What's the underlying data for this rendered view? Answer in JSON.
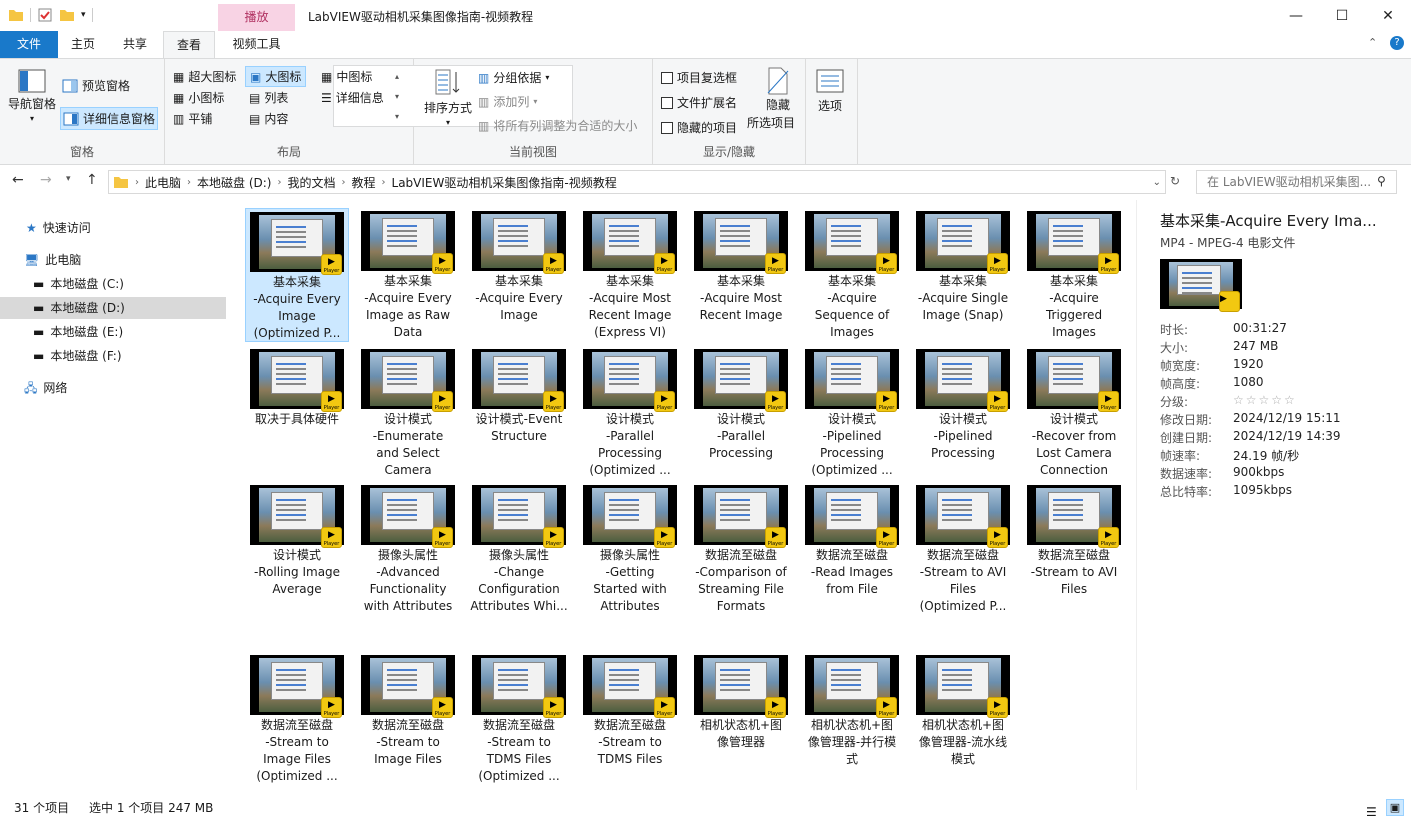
{
  "window": {
    "title": "LabVIEW驱动相机采集图像指南-视频教程",
    "play_tab": "播放",
    "minimize": "—",
    "maximize": "☐",
    "close": "✕"
  },
  "tabs": [
    "文件",
    "主页",
    "共享",
    "查看",
    "视频工具"
  ],
  "ribbon": {
    "pane": {
      "nav_pane": "导航窗格",
      "preview_pane": "预览窗格",
      "details_pane": "详细信息窗格",
      "label": "窗格"
    },
    "layout": {
      "items": [
        "超大图标",
        "大图标",
        "中图标",
        "小图标",
        "列表",
        "详细信息",
        "平铺",
        "内容"
      ],
      "label": "布局"
    },
    "view": {
      "sort": "排序方式",
      "group_by": "分组依据",
      "add_column": "添加列",
      "fit_columns": "将所有列调整为合适的大小",
      "label": "当前视图"
    },
    "show": {
      "item_checkbox": "项目复选框",
      "file_ext": "文件扩展名",
      "hidden_items": "隐藏的项目",
      "hide_selected": "隐藏",
      "hide_selected2": "所选项目",
      "label": "显示/隐藏"
    },
    "options": "选项"
  },
  "address": {
    "crumbs": [
      "此电脑",
      "本地磁盘 (D:)",
      "我的文档",
      "教程",
      "LabVIEW驱动相机采集图像指南-视频教程"
    ],
    "search_placeholder": "在 LabVIEW驱动相机采集图..."
  },
  "nav": {
    "quick": "快速访问",
    "pc": "此电脑",
    "c": "本地磁盘 (C:)",
    "d": "本地磁盘 (D:)",
    "e": "本地磁盘 (E:)",
    "f": "本地磁盘 (F:)",
    "net": "网络"
  },
  "files": [
    "基本采集\n-Acquire Every\nImage\n(Optimized P...",
    "基本采集\n-Acquire Every\nImage as Raw\nData",
    "基本采集\n-Acquire Every\nImage",
    "基本采集\n-Acquire Most\nRecent Image\n(Express VI)",
    "基本采集\n-Acquire Most\nRecent Image",
    "基本采集\n-Acquire\nSequence of\nImages",
    "基本采集\n-Acquire Single\nImage (Snap)",
    "基本采集\n-Acquire\nTriggered\nImages",
    "取决于具体硬件",
    "设计模式\n-Enumerate\nand Select\nCamera",
    "设计模式-Event\nStructure",
    "设计模式\n-Parallel\nProcessing\n(Optimized ...",
    "设计模式\n-Parallel\nProcessing",
    "设计模式\n-Pipelined\nProcessing\n(Optimized ...",
    "设计模式\n-Pipelined\nProcessing",
    "设计模式\n-Recover from\nLost Camera\nConnection",
    "设计模式\n-Rolling Image\nAverage",
    "摄像头属性\n-Advanced\nFunctionality\nwith Attributes",
    "摄像头属性\n-Change\nConfiguration\nAttributes Whi...",
    "摄像头属性\n-Getting\nStarted with\nAttributes",
    "数据流至磁盘\n-Comparison of\nStreaming File\nFormats",
    "数据流至磁盘\n-Read Images\nfrom File",
    "数据流至磁盘\n-Stream to AVI\nFiles\n(Optimized P...",
    "数据流至磁盘\n-Stream to AVI\nFiles",
    "数据流至磁盘\n-Stream to\nImage Files\n(Optimized ...",
    "数据流至磁盘\n-Stream to\nImage Files",
    "数据流至磁盘\n-Stream to\nTDMS Files\n(Optimized ...",
    "数据流至磁盘\n-Stream to\nTDMS Files",
    "相机状态机+图\n像管理器",
    "相机状态机+图\n像管理器-并行模\n式",
    "相机状态机+图\n像管理器-流水线\n模式"
  ],
  "badge": "Player",
  "details": {
    "title": "基本采集-Acquire Every Ima...",
    "type": "MP4 - MPEG-4 电影文件",
    "rows": [
      [
        "时长:",
        "00:31:27"
      ],
      [
        "大小:",
        "247 MB"
      ],
      [
        "帧宽度:",
        "1920"
      ],
      [
        "帧高度:",
        "1080"
      ],
      [
        "分级:",
        "☆☆☆☆☆"
      ],
      [
        "修改日期:",
        "2024/12/19 15:11"
      ],
      [
        "创建日期:",
        "2024/12/19 14:39"
      ],
      [
        "帧速率:",
        "24.19 帧/秒"
      ],
      [
        "数据速率:",
        "900kbps"
      ],
      [
        "总比特率:",
        "1095kbps"
      ]
    ]
  },
  "status": {
    "count": "31 个项目",
    "selected": "选中 1 个项目  247 MB"
  }
}
